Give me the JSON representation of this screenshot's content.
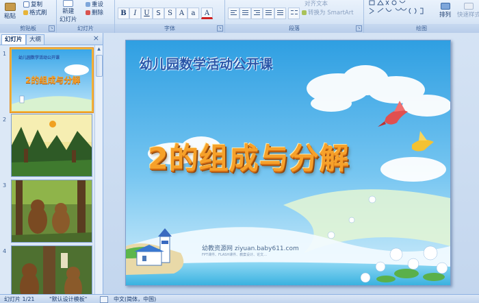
{
  "ribbon": {
    "clipboard": {
      "paste": "粘贴",
      "copy": "复制",
      "format_painter": "格式刷",
      "label": "剪贴板"
    },
    "slides": {
      "new_slide_line1": "新建",
      "new_slide_line2": "幻灯片",
      "reset": "重设",
      "delete": "删除",
      "label": "幻灯片"
    },
    "font": {
      "label": "字体"
    },
    "paragraph": {
      "align_text": "对齐文本",
      "convert_smartart": "转换为 SmartArt",
      "label": "段落"
    },
    "drawing": {
      "arrange": "排列",
      "quick_styles": "快速样式",
      "label": "绘图"
    }
  },
  "pane": {
    "tab_slides": "幻灯片",
    "tab_outline": "大纲",
    "close": "×",
    "thumbnails": [
      {
        "number": "1",
        "title": "幼儿园数学活动公开课",
        "heading": "2的组成与分解",
        "selected": true
      },
      {
        "number": "2",
        "selected": false
      },
      {
        "number": "3",
        "selected": false
      },
      {
        "number": "4",
        "selected": false
      }
    ]
  },
  "slide": {
    "title": "幼儿园数学活动公开课",
    "heading": "2的组成与分解",
    "watermark": "幼教资源网 ziyuan.baby611.com",
    "watermark_sub": "FPT课件、FLASH课件、教案设计、论文…"
  },
  "statusbar": {
    "slide_info": "幻灯片 1/21",
    "theme": "\"默认设计模板\"",
    "language": "中文(简体，中国)"
  },
  "colors": {
    "accent": "#2a56a8",
    "heading_orange": "#f6a12a",
    "ribbon_bg": "#dbe8f7",
    "selection": "#f2b43a"
  }
}
